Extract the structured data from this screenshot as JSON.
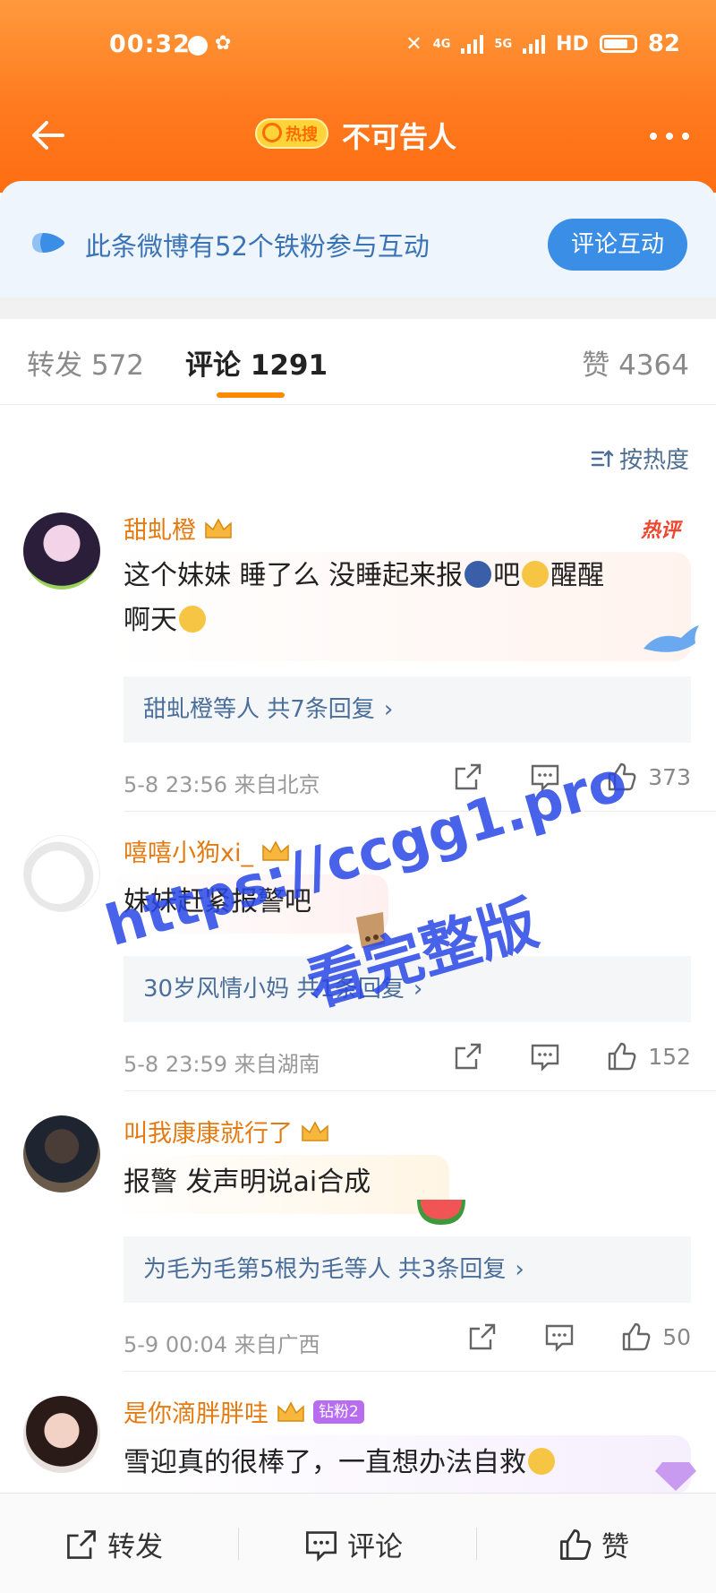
{
  "status": {
    "time": "00:32",
    "network": "4G",
    "network2": "5G",
    "hd": "HD",
    "battery": "82"
  },
  "nav": {
    "hot_label": "热搜",
    "title": "不可告人"
  },
  "fan_banner": {
    "text": "此条微博有52个铁粉参与互动",
    "button": "评论互动"
  },
  "tabs": {
    "repost": "转发 572",
    "comment": "评论 1291",
    "like": "赞 4364"
  },
  "sort_label": "按热度",
  "comments": [
    {
      "name": "甜虬橙",
      "hot": "热评",
      "text": "这个妹妹 睡了么 没睡起来报",
      "text_after": "吧",
      "text_tail": "醒醒",
      "text_line2": "啊天",
      "replies": "甜虬橙等人 共7条回复",
      "meta": "5-8 23:56 来自北京",
      "likes": "373"
    },
    {
      "name": "嘻嘻小狗xi_",
      "text": "妹妹赶紧报警吧",
      "replies": "30岁风情小妈 共1条回复",
      "meta": "5-8 23:59 来自湖南",
      "likes": "152"
    },
    {
      "name": "叫我康康就行了",
      "text": "报警 发声明说ai合成",
      "replies": "为毛为毛第5根为毛等人 共3条回复",
      "meta": "5-9 00:04 来自广西",
      "likes": "50"
    },
    {
      "name": "是你滴胖胖哇",
      "fan_tag": "钻粉2",
      "text": "雪迎真的很棒了，一直想办法自救"
    }
  ],
  "watermark": {
    "line1": "https://ccgg1.pro",
    "line2": "看完整版"
  },
  "bottom_bar": {
    "repost": "转发",
    "comment": "评论",
    "like": "赞"
  },
  "colors": {
    "header_orange": "#ff7a1f",
    "name_orange": "#e47b12",
    "link_blue": "#4a6f9a",
    "accent": "#ff8a00"
  }
}
